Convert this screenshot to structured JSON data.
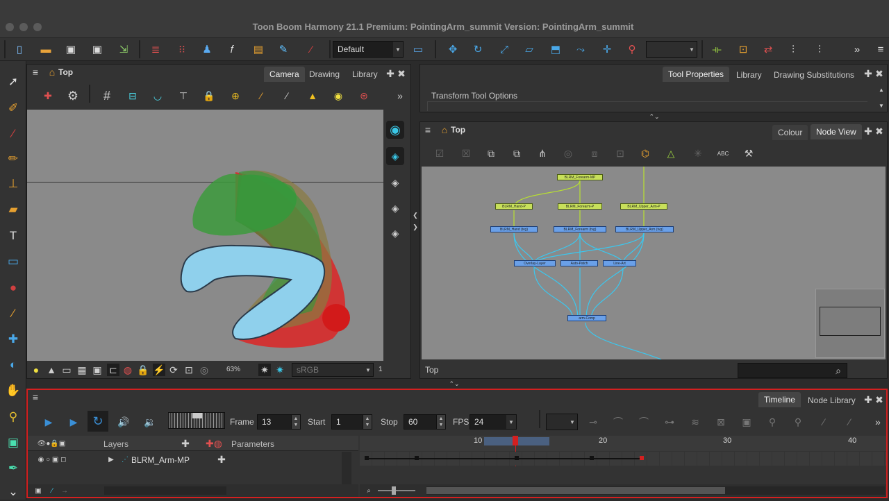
{
  "window": {
    "title": "Toon Boom Harmony 21.1 Premium: PointingArm_summit Version: PointingArm_summit"
  },
  "toolbar": {
    "workspace_value": "Default"
  },
  "camera_view": {
    "breadcrumb": "Top",
    "tabs": [
      "Camera",
      "Drawing",
      "Library"
    ],
    "active_tab": "Camera",
    "zoom": "63%",
    "colorspace": "sRGB",
    "frame_readout": "1"
  },
  "tool_properties": {
    "tabs": [
      "Tool Properties",
      "Library",
      "Drawing Substitutions"
    ],
    "active_tab": "Tool Properties",
    "title": "Transform Tool Options"
  },
  "node_view": {
    "breadcrumb": "Top",
    "tabs": [
      "Colour",
      "Node View"
    ],
    "active_tab": "Node View",
    "status": "Top",
    "nodes": [
      {
        "label": "BLRM_Forearm-MP",
        "kind": "green"
      },
      {
        "label": "BLRM_Hand-P",
        "kind": "green"
      },
      {
        "label": "BLRM_Forearm-P",
        "kind": "green"
      },
      {
        "label": "BLRM_Upper_Arm-P",
        "kind": "green"
      },
      {
        "label": "BLRM_Hand (tvg)",
        "kind": "blue"
      },
      {
        "label": "BLRM_Forearm (tvg)",
        "kind": "blue"
      },
      {
        "label": "BLRM_Upper_Arm (tvg)",
        "kind": "blue"
      },
      {
        "label": "Overlay-Layer",
        "kind": "blue"
      },
      {
        "label": "Auto-Patch",
        "kind": "blue"
      },
      {
        "label": "Line-Art",
        "kind": "blue"
      },
      {
        "label": "arm-Comp",
        "kind": "blue"
      }
    ]
  },
  "timeline": {
    "tabs": [
      "Timeline",
      "Node Library"
    ],
    "active_tab": "Timeline",
    "frame_label": "Frame",
    "frame_value": "13",
    "start_label": "Start",
    "start_value": "1",
    "stop_label": "Stop",
    "stop_value": "60",
    "fps_label": "FPS",
    "fps_value": "24",
    "layers_header": "Layers",
    "parameters_header": "Parameters",
    "layer_name": "BLRM_Arm-MP",
    "ruler_ticks": [
      "10",
      "20",
      "30",
      "40"
    ]
  },
  "colors": {
    "accent_blue": "#3a8fd6",
    "red_highlight": "#d42020",
    "node_green": "#c8e05a",
    "node_blue": "#6aa0e8"
  }
}
